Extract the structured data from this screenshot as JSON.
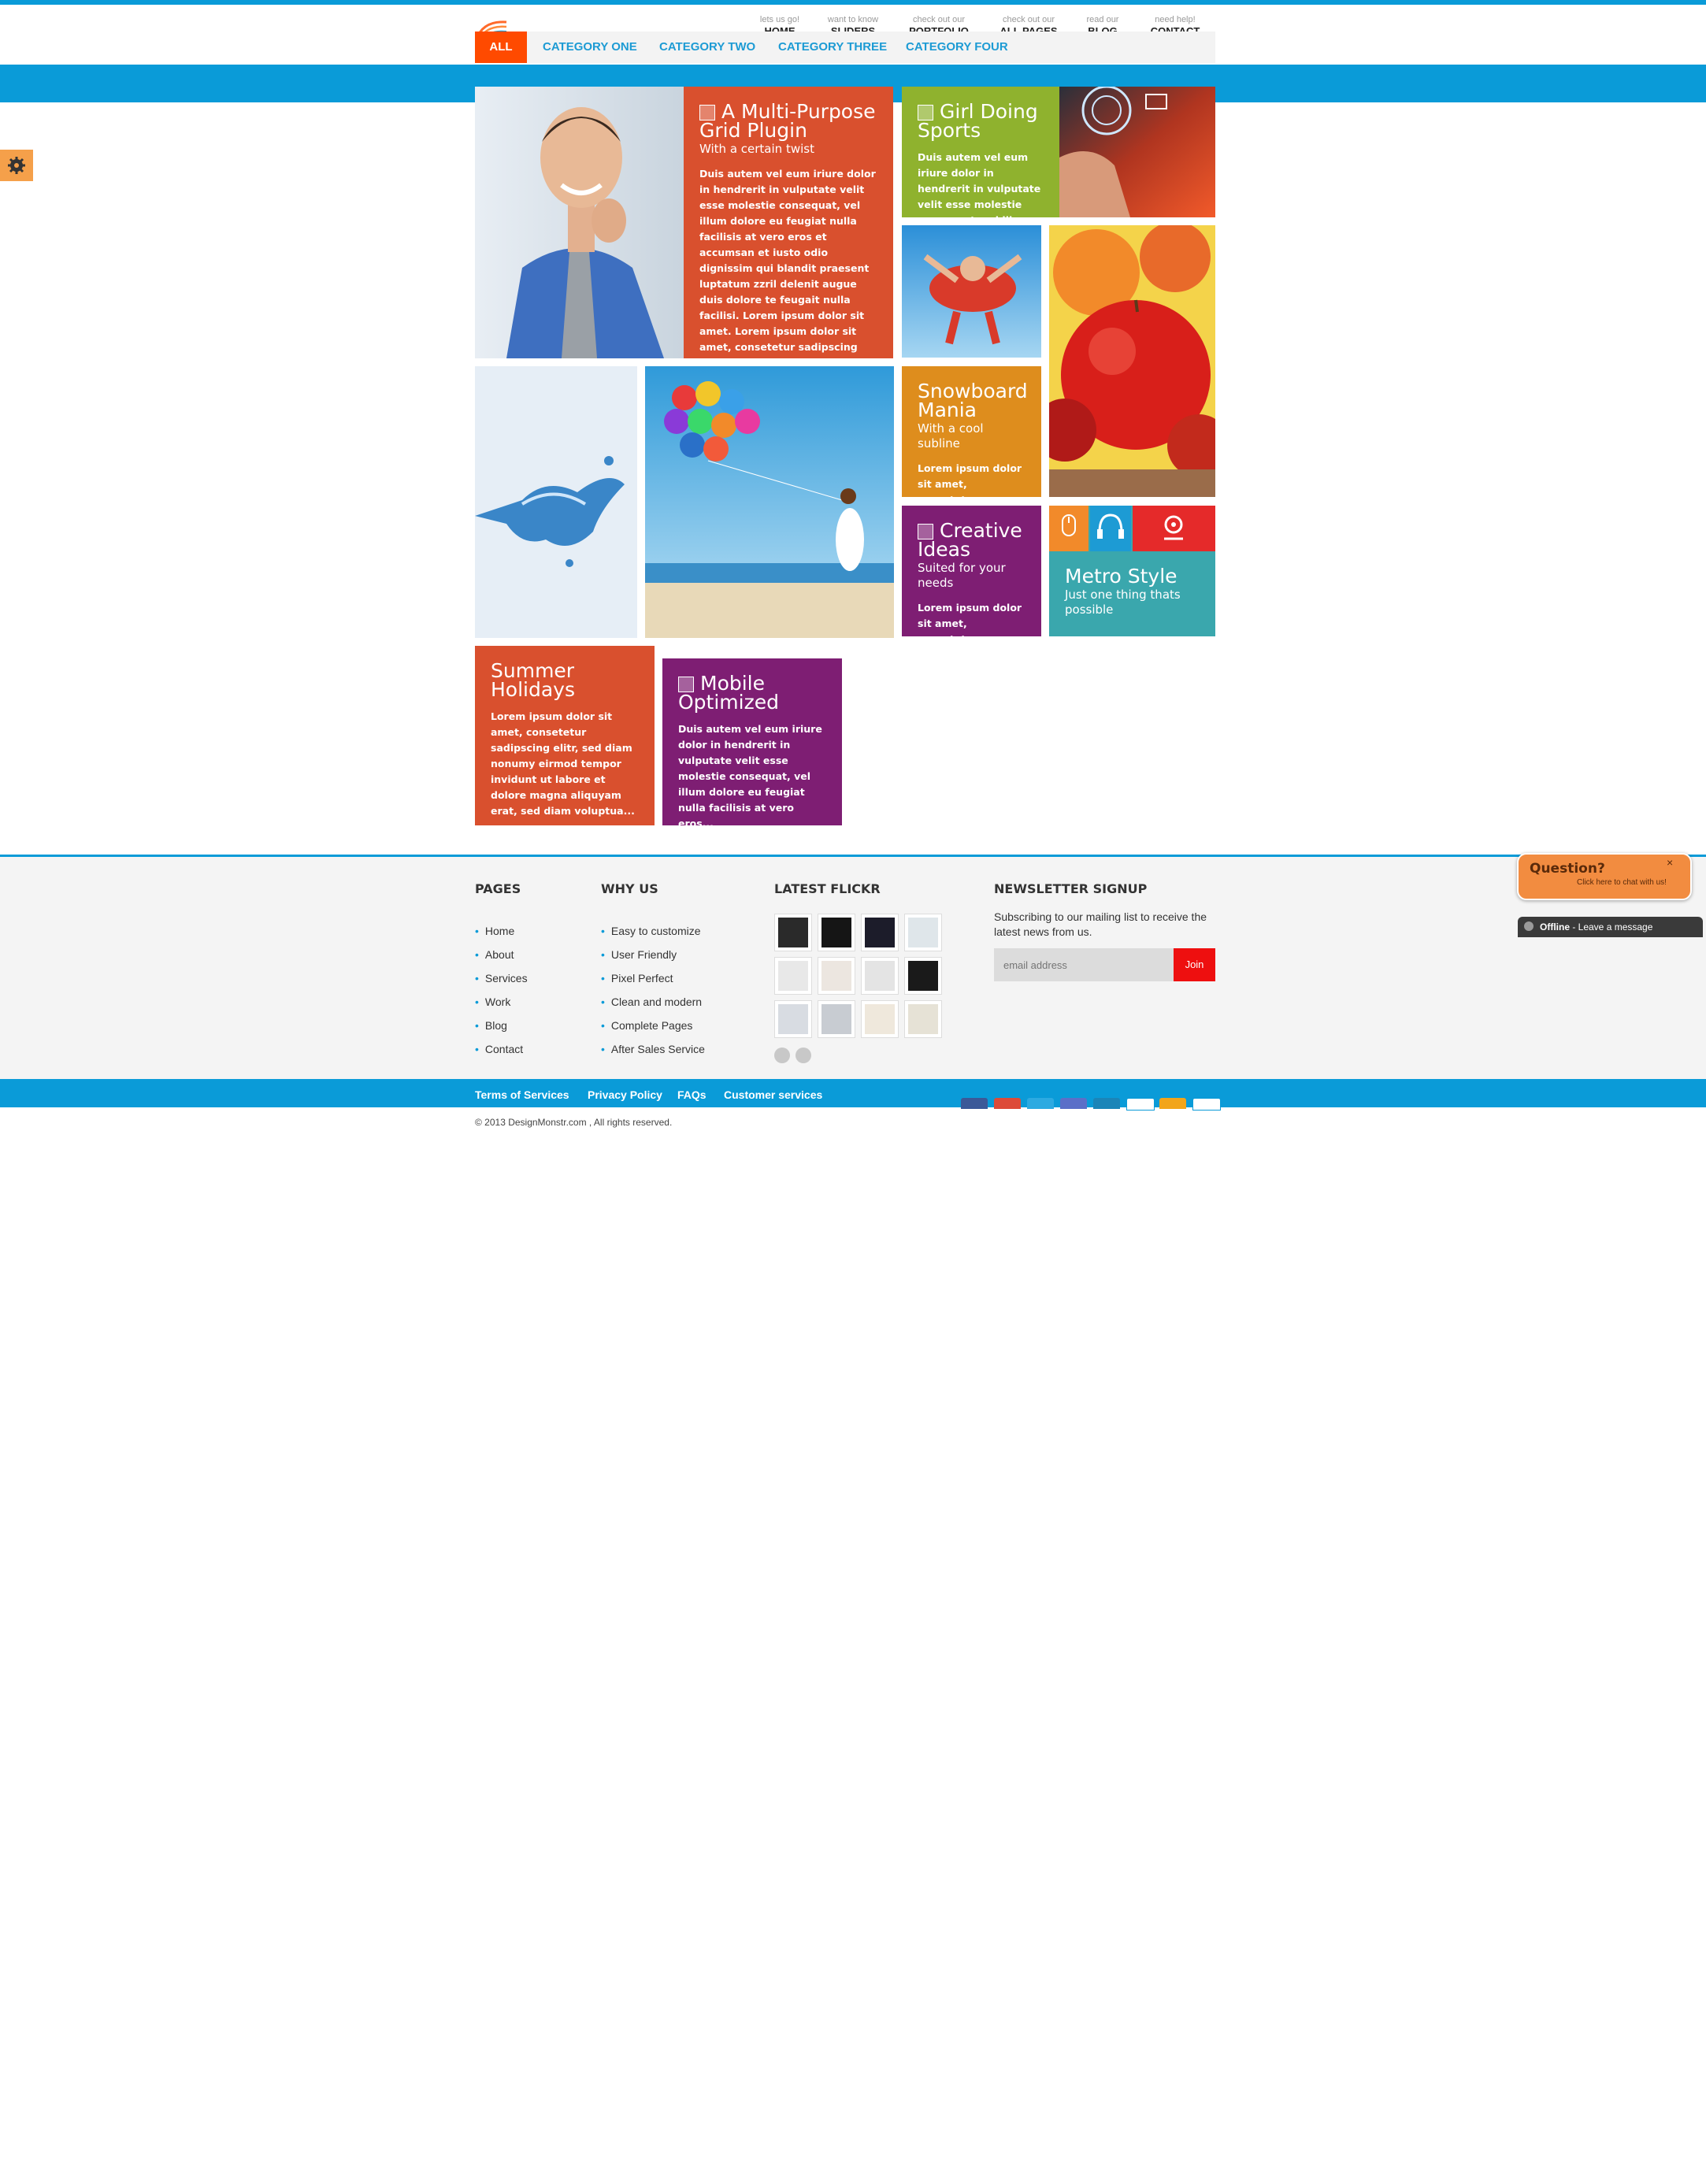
{
  "nav": [
    {
      "sub": "lets us go!",
      "label": "HOME"
    },
    {
      "sub": "want to know",
      "label": "SLIDERS"
    },
    {
      "sub": "check out our",
      "label": "PORTFOLIO"
    },
    {
      "sub": "check out our",
      "label": "ALL PAGES"
    },
    {
      "sub": "read our",
      "label": "BLOG"
    },
    {
      "sub": "need help!",
      "label": "CONTACT"
    }
  ],
  "categories": [
    "ALL",
    "CATEGORY ONE",
    "CATEGORY TWO",
    "CATEGORY THREE",
    "CATEGORY FOUR"
  ],
  "tiles": {
    "multipurpose": {
      "title": "A Multi-Purpose Grid Plugin",
      "subtitle": "With a certain twist",
      "body": "Duis autem vel eum iriure dolor in hendrerit in vulputate velit esse molestie consequat, vel illum dolore eu feugiat nulla facilisis at vero eros et accumsan et iusto odio dignissim qui blandit praesent luptatum zzril delenit augue duis dolore te feugait nulla facilisi. Lorem ipsum dolor sit amet. Lorem ipsum dolor sit amet, consetetur sadipscing elitr, sed diam nonumy eirmod tempor invidunt ut labore et dolore magna aliquyam"
    },
    "sports": {
      "title": "Girl Doing Sports",
      "body": "Duis autem vel eum iriure dolor in hendrerit in vulputate velit esse molestie consequat, vel illum dolore eu feugiat"
    },
    "snowboard": {
      "title": "Snowboard Mania",
      "subtitle": "With a cool subline",
      "body": "Lorem ipsum dolor sit amet, consetetur sadipscing elitr, sed"
    },
    "creative": {
      "title": "Creative Ideas",
      "subtitle": "Suited for your needs",
      "body": "Lorem ipsum dolor sit amet, consetetur"
    },
    "metro": {
      "title": "Metro Style",
      "subtitle": "Just one thing thats possible"
    },
    "summer": {
      "title": "Summer Holidays",
      "body": "Lorem ipsum dolor sit amet, consetetur sadipscing elitr, sed diam nonumy eirmod tempor invidunt ut labore et dolore magna aliquyam erat, sed diam voluptua..."
    },
    "mobile": {
      "title": "Mobile Optimized",
      "body": "Duis autem vel eum iriure dolor in hendrerit in vulputate velit esse molestie consequat, vel illum dolore eu feugiat nulla facilisis at vero eros..."
    }
  },
  "footer": {
    "pages_heading": "PAGES",
    "pages": [
      "Home",
      "About",
      "Services",
      "Work",
      "Blog",
      "Contact"
    ],
    "whyus_heading": "WHY US",
    "whyus": [
      "Easy to customize",
      "User Friendly",
      "Pixel Perfect",
      "Clean and modern",
      "Complete Pages",
      "After Sales Service"
    ],
    "flickr_heading": "LATEST FLICKR",
    "newsletter_heading": "NEWSLETTER SIGNUP",
    "newsletter_text": "Subscribing to our mailing list to receive the latest news from us.",
    "email_placeholder": "email address",
    "join_label": "Join"
  },
  "chat": {
    "question": "Question?",
    "hint": "Click here to chat with us!",
    "close": "×",
    "status": "Offline",
    "status_suffix": " - Leave a message"
  },
  "bottom_links": [
    "Terms of Services",
    "Privacy Policy",
    "FAQs",
    "Customer services"
  ],
  "copyright": "© 2013 DesignMonstr.com , All rights reserved.",
  "social": [
    "facebook",
    "google-plus",
    "twitter",
    "forrst",
    "linkedin",
    "blogger",
    "amazon",
    "dropbox"
  ],
  "colors": {
    "accent_blue": "#0a9bd8",
    "active_category": "#ff4a00",
    "tile_red": "#d9502e",
    "tile_green": "#8fb22e",
    "tile_orange": "#de8d1d",
    "tile_purple": "#7e1e73",
    "tile_teal": "#3aa7ad"
  }
}
